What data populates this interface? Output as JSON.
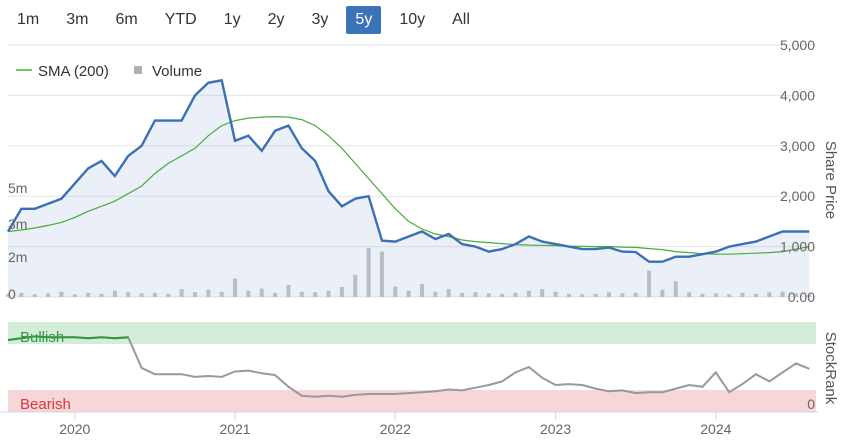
{
  "range_buttons": [
    {
      "label": "1m",
      "active": false
    },
    {
      "label": "3m",
      "active": false
    },
    {
      "label": "6m",
      "active": false
    },
    {
      "label": "YTD",
      "active": false
    },
    {
      "label": "1y",
      "active": false
    },
    {
      "label": "2y",
      "active": false
    },
    {
      "label": "3y",
      "active": false
    },
    {
      "label": "5y",
      "active": true
    },
    {
      "label": "10y",
      "active": false
    },
    {
      "label": "All",
      "active": false
    }
  ],
  "legend": {
    "sma_label": "SMA (200)",
    "volume_label": "Volume"
  },
  "colors": {
    "price": "#3b6fb6",
    "sma": "#4aaa3a",
    "volume": "#c8c8c8",
    "stockrank": "#999999",
    "bullish_bg": "#d4edd9",
    "bearish_bg": "#f6d6d8",
    "bullish_text": "#2e9a3e",
    "bearish_text": "#d9363e",
    "active_button": "#3b73b9"
  },
  "chart_data": {
    "type": "line",
    "x_ticks": [
      "2020",
      "2021",
      "2022",
      "2023",
      "2024"
    ],
    "price_axis": {
      "title": "Share Price",
      "ticks": [
        "5,000",
        "4,000",
        "3,000",
        "2,000",
        "1,000",
        "0.00"
      ],
      "range": [
        0,
        5000
      ]
    },
    "volume_axis": {
      "ticks": [
        "5m",
        "3m",
        "2m",
        "0"
      ],
      "range": [
        0,
        11000000
      ]
    },
    "stockrank_axis": {
      "title": "StockRank",
      "zones": {
        "bullish": "Bullish",
        "bearish": "Bearish"
      },
      "ticks": [
        "0"
      ],
      "range": [
        0,
        100
      ]
    },
    "x": [
      "2019-08",
      "2019-09",
      "2019-10",
      "2019-11",
      "2019-12",
      "2020-01",
      "2020-02",
      "2020-03",
      "2020-04",
      "2020-05",
      "2020-06",
      "2020-07",
      "2020-08",
      "2020-09",
      "2020-10",
      "2020-11",
      "2020-12",
      "2021-01",
      "2021-02",
      "2021-03",
      "2021-04",
      "2021-05",
      "2021-06",
      "2021-07",
      "2021-08",
      "2021-09",
      "2021-10",
      "2021-11",
      "2021-12",
      "2022-01",
      "2022-02",
      "2022-03",
      "2022-04",
      "2022-05",
      "2022-06",
      "2022-07",
      "2022-08",
      "2022-09",
      "2022-10",
      "2022-11",
      "2022-12",
      "2023-01",
      "2023-02",
      "2023-03",
      "2023-04",
      "2023-05",
      "2023-06",
      "2023-07",
      "2023-08",
      "2023-09",
      "2023-10",
      "2023-11",
      "2023-12",
      "2024-01",
      "2024-02",
      "2024-03",
      "2024-04",
      "2024-05",
      "2024-06",
      "2024-07",
      "2024-08"
    ],
    "series": [
      {
        "name": "Price",
        "values": [
          1300,
          1750,
          1750,
          1850,
          1950,
          2250,
          2550,
          2700,
          2400,
          2800,
          3000,
          3500,
          3500,
          3500,
          4000,
          4250,
          4300,
          3100,
          3200,
          2900,
          3300,
          3400,
          2950,
          2700,
          2100,
          1800,
          1950,
          2000,
          1120,
          1100,
          1200,
          1300,
          1150,
          1250,
          1050,
          1000,
          900,
          950,
          1050,
          1200,
          1100,
          1050,
          1000,
          950,
          950,
          980,
          900,
          890,
          700,
          700,
          800,
          800,
          850,
          900,
          1000,
          1050,
          1100,
          1200,
          1300,
          1300,
          1300
        ]
      },
      {
        "name": "SMA (200)",
        "values": [
          1300,
          1330,
          1370,
          1420,
          1480,
          1580,
          1700,
          1800,
          1900,
          2050,
          2200,
          2450,
          2650,
          2800,
          2950,
          3200,
          3400,
          3500,
          3550,
          3570,
          3580,
          3570,
          3520,
          3400,
          3200,
          2950,
          2650,
          2350,
          2050,
          1750,
          1500,
          1350,
          1250,
          1200,
          1130,
          1100,
          1080,
          1060,
          1040,
          1030,
          1025,
          1020,
          1010,
          1005,
          1000,
          1000,
          990,
          985,
          960,
          940,
          900,
          880,
          860,
          850,
          850,
          860,
          870,
          880,
          900,
          950,
          1000
        ]
      },
      {
        "name": "Volume",
        "values": [
          0.6,
          0.8,
          0.5,
          0.7,
          1.0,
          0.5,
          0.8,
          0.6,
          1.2,
          0.9,
          0.7,
          0.8,
          0.6,
          1.5,
          0.9,
          1.4,
          1.0,
          3.5,
          1.2,
          1.6,
          0.8,
          2.3,
          1.0,
          0.9,
          1.2,
          1.9,
          4.2,
          9.3,
          8.6,
          2.0,
          1.2,
          2.5,
          1.0,
          1.5,
          0.8,
          0.9,
          0.7,
          0.6,
          0.8,
          1.2,
          1.5,
          1.0,
          0.6,
          0.5,
          0.6,
          0.9,
          0.7,
          0.8,
          5.0,
          1.4,
          3.0,
          0.9,
          0.6,
          0.7,
          0.5,
          0.8,
          0.6,
          0.9,
          1.0,
          0.7,
          0.5
        ]
      },
      {
        "name": "StockRank",
        "values": [
          80,
          82,
          84,
          83,
          83,
          83,
          82,
          83,
          82,
          83,
          49,
          42,
          42,
          42,
          39,
          40,
          39,
          45,
          46,
          43,
          41,
          28,
          18,
          17,
          18,
          17,
          19,
          20,
          20,
          20,
          21,
          22,
          23,
          25,
          24,
          27,
          30,
          34,
          44,
          50,
          38,
          30,
          31,
          30,
          26,
          23,
          24,
          21,
          22,
          22,
          26,
          30,
          28,
          44,
          22,
          31,
          42,
          34,
          44,
          54,
          48
        ]
      }
    ]
  }
}
